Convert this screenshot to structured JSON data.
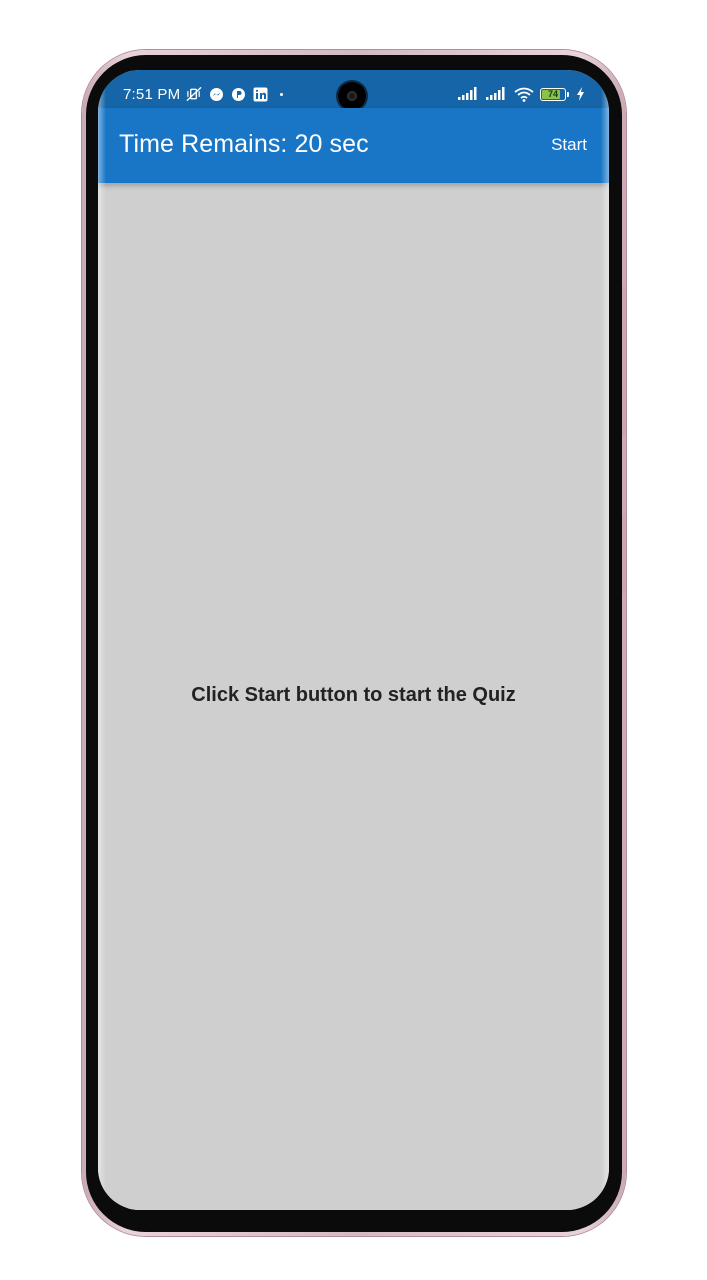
{
  "status_bar": {
    "time": "7:51 PM",
    "battery_level": "74",
    "left_icons": [
      "mute-vibrate-icon",
      "messenger-icon",
      "app-p-icon",
      "linkedin-icon",
      "more-dot-icon"
    ],
    "right_icons": [
      "signal-1-icon",
      "signal-2-icon",
      "wifi-icon",
      "battery-icon",
      "charging-icon"
    ]
  },
  "app_bar": {
    "title": "Time Remains: 20 sec",
    "start_label": "Start"
  },
  "main": {
    "prompt": "Click Start button to start the Quiz"
  },
  "colors": {
    "status_bar": "#1565a8",
    "app_bar": "#1976c6",
    "background": "#cfcfcf",
    "text": "#222222",
    "phone_frame": "#d5b9c2"
  }
}
